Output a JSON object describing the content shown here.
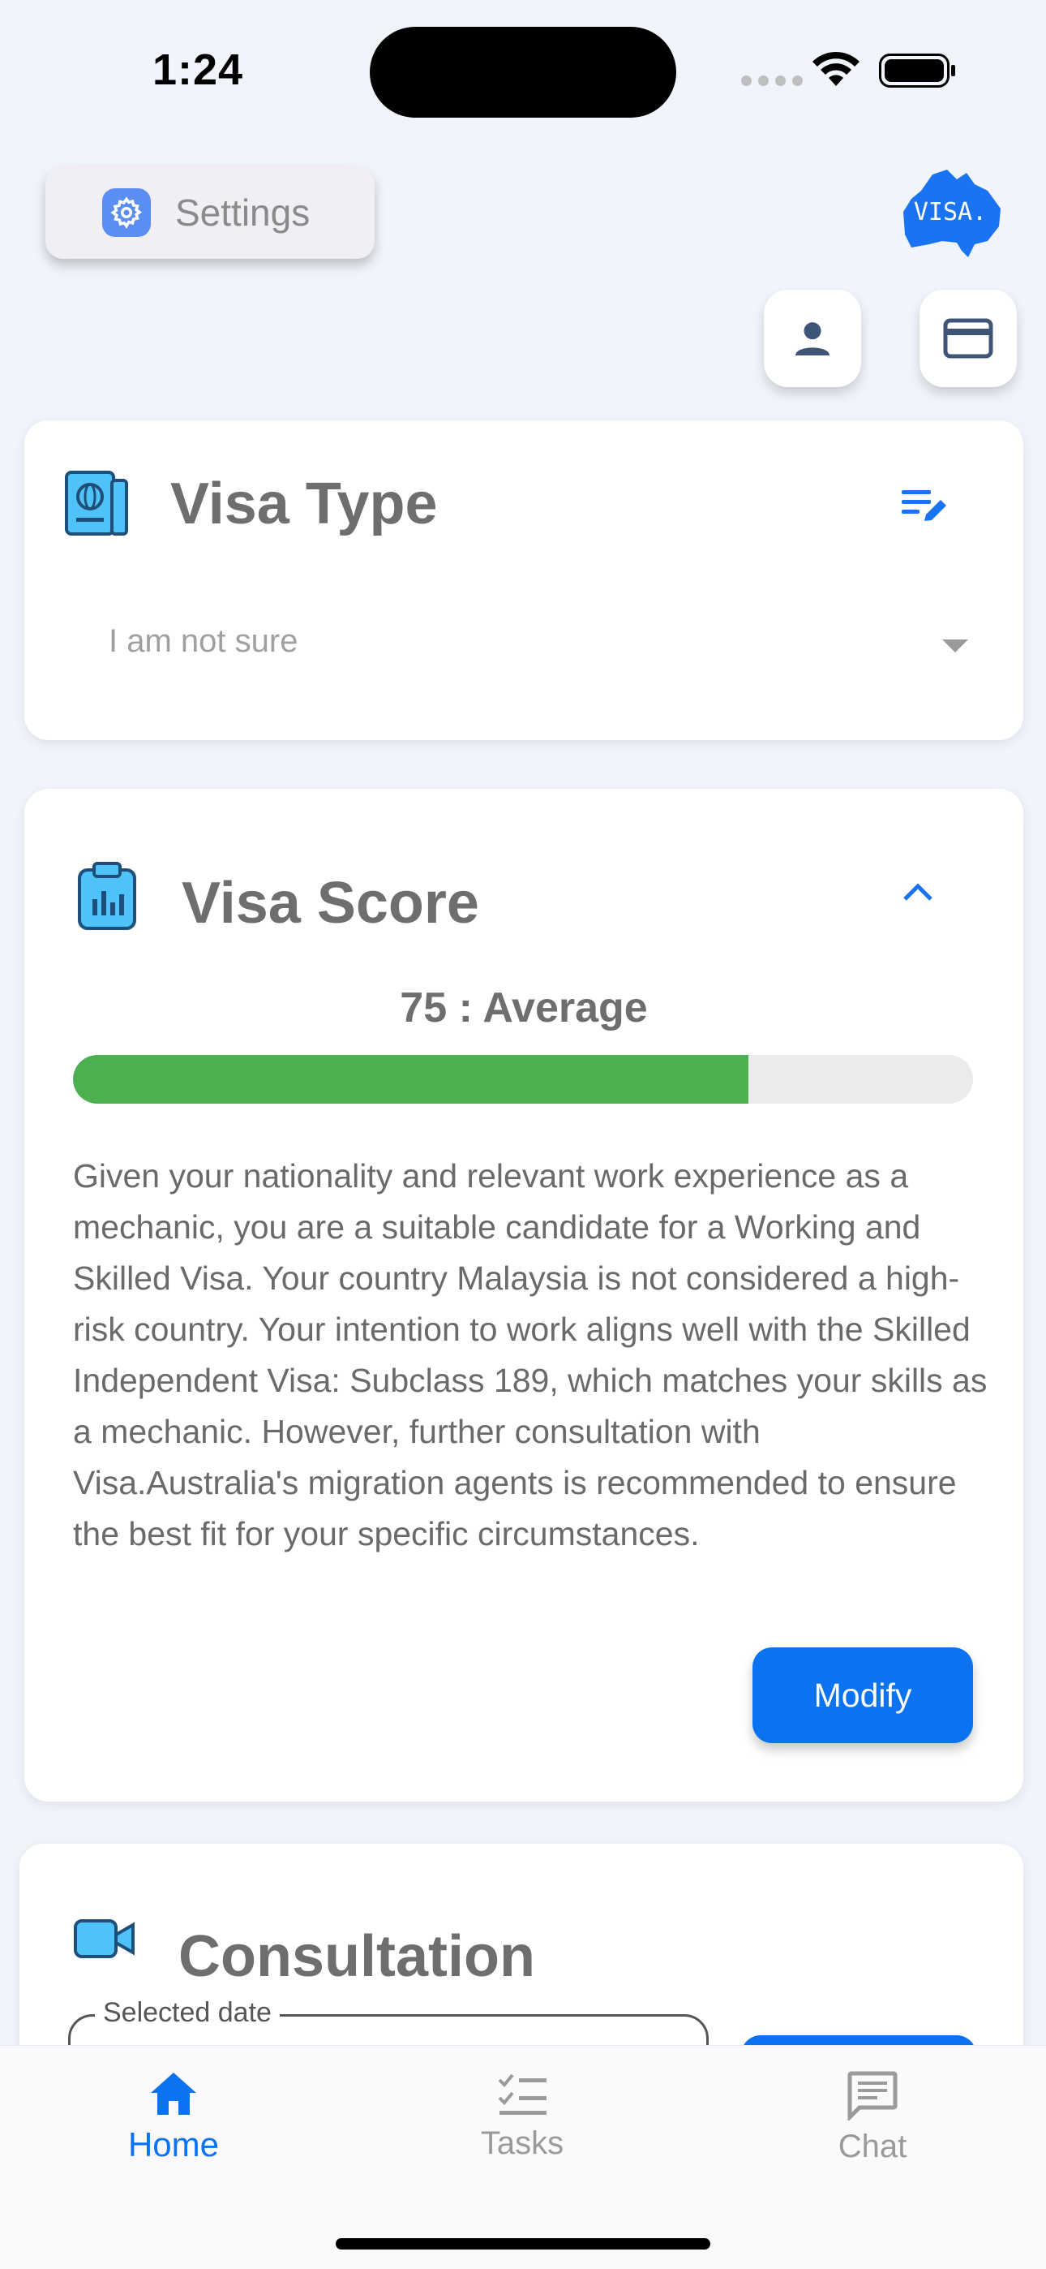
{
  "status_bar": {
    "time": "1:24"
  },
  "header": {
    "settings_label": "Settings",
    "logo_text": "VISA."
  },
  "visa_type": {
    "title": "Visa Type",
    "selected": "I am not sure"
  },
  "visa_score": {
    "title": "Visa Score",
    "score": 75,
    "score_label": "75 : Average",
    "progress_percent": 75,
    "description": "Given your nationality and relevant work experience as a mechanic, you are a suitable candidate for a Working and Skilled Visa. Your country Malaysia is not considered a high-risk country. Your intention to work aligns well with the Skilled Independent Visa: Subclass 189, which matches your skills as a mechanic. However, further consultation with Visa.Australia's migration agents is recommended to ensure the best fit for your specific circumstances.",
    "modify_label": "Modify"
  },
  "consultation": {
    "title": "Consultation",
    "date_label": "Selected date"
  },
  "tabs": [
    {
      "label": "Home",
      "icon": "home-icon",
      "active": true
    },
    {
      "label": "Tasks",
      "icon": "tasks-icon",
      "active": false
    },
    {
      "label": "Chat",
      "icon": "chat-icon",
      "active": false
    }
  ],
  "colors": {
    "accent": "#0b72f0",
    "progress": "#4caf50",
    "background": "#f1f5fb"
  }
}
